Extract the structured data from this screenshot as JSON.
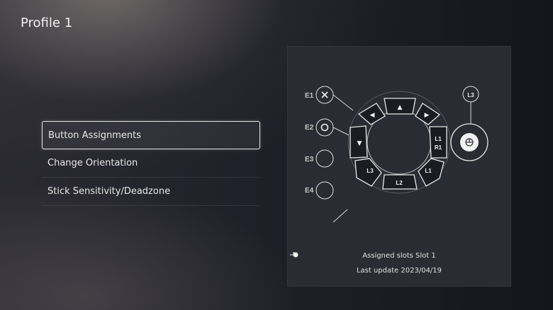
{
  "header": {
    "title": "Profile 1"
  },
  "menu": {
    "items": [
      {
        "label": "Button Assignments"
      },
      {
        "label": "Change Orientation"
      },
      {
        "label": "Stick Sensitivity/Deadzone"
      }
    ]
  },
  "panel": {
    "expansion_labels": [
      "E1",
      "E2",
      "E3",
      "E4"
    ],
    "expansion_icons": [
      "cross-icon",
      "circle-icon",
      "empty",
      "empty"
    ],
    "stick_label": "L3",
    "ring_buttons": {
      "left": "◀",
      "up": "▲",
      "right": "▶",
      "down": "▼",
      "l1r1_top": "L1",
      "l1r1_bottom": "R1",
      "l1": "L1",
      "l2": "L2",
      "l3": "L3"
    },
    "assigned_slots_label": "Assigned slots",
    "slot": "Slot 1",
    "last_update_label": "Last update",
    "last_update_date": "2023/04/19"
  },
  "colors": {
    "accent_white": "#e9e9e9",
    "panel_bg": "#2a2c33"
  }
}
